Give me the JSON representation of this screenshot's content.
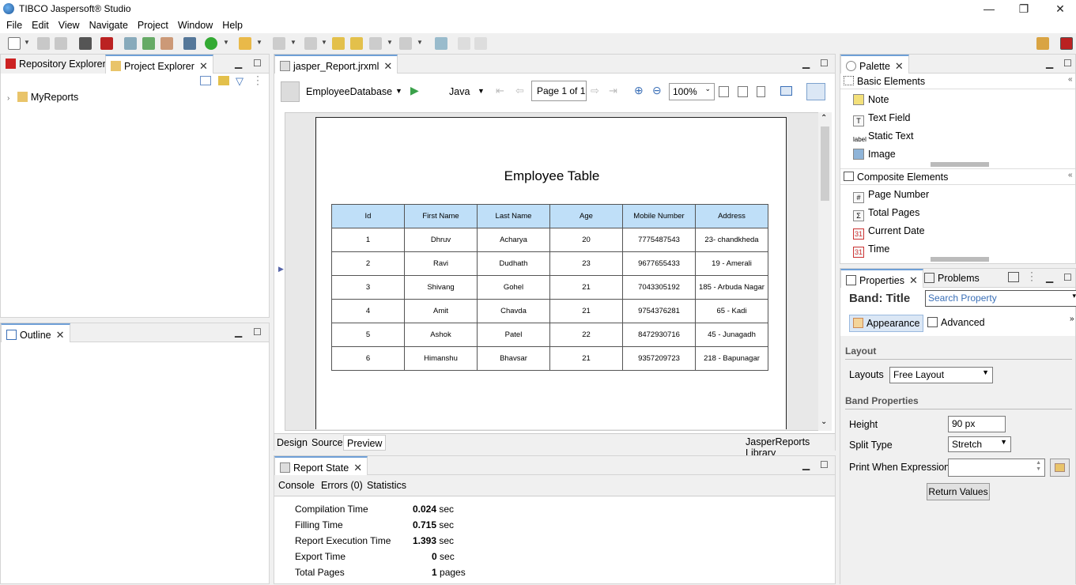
{
  "window": {
    "title": "TIBCO Jaspersoft® Studio",
    "minimize": "—",
    "restore": "❐",
    "close": "✕"
  },
  "menu": [
    "File",
    "Edit",
    "View",
    "Navigate",
    "Project",
    "Window",
    "Help"
  ],
  "left_panel": {
    "tabs": [
      {
        "label": "Repository Explorer"
      },
      {
        "label": "Project Explorer"
      }
    ],
    "tree": [
      {
        "label": "MyReports"
      }
    ]
  },
  "outline_panel": {
    "tab_label": "Outline"
  },
  "editor": {
    "tab_label": "jasper_Report.jrxml",
    "datasource": "EmployeeDatabase",
    "language": "Java",
    "page_indicator": "Page 1 of 1",
    "zoom": "100%",
    "bottom_tabs": [
      "Design",
      "Source",
      "Preview"
    ],
    "library_label": "JasperReports Library",
    "report": {
      "title": "Employee Table",
      "columns": [
        "Id",
        "First Name",
        "Last Name",
        "Age",
        "Mobile Number",
        "Address"
      ],
      "rows": [
        [
          "1",
          "Dhruv",
          "Acharya",
          "20",
          "7775487543",
          "23- chandkheda"
        ],
        [
          "2",
          "Ravi",
          "Dudhath",
          "23",
          "9677655433",
          "19 - Amerali"
        ],
        [
          "3",
          "Shivang",
          "Gohel",
          "21",
          "7043305192",
          "185 - Arbuda Nagar"
        ],
        [
          "4",
          "Amit",
          "Chavda",
          "21",
          "9754376281",
          "65 - Kadi"
        ],
        [
          "5",
          "Ashok",
          "Patel",
          "22",
          "8472930716",
          "45 - Junagadh"
        ],
        [
          "6",
          "Himanshu",
          "Bhavsar",
          "21",
          "9357209723",
          "218 - Bapunagar"
        ]
      ]
    }
  },
  "report_state": {
    "tab_label": "Report State",
    "subtabs": [
      "Console",
      "Errors (0)",
      "Statistics"
    ],
    "stats": [
      {
        "label": "Compilation Time",
        "value": "0.024",
        "unit": "sec"
      },
      {
        "label": "Filling Time",
        "value": "0.715",
        "unit": "sec"
      },
      {
        "label": "Report Execution Time",
        "value": "1.393",
        "unit": "sec"
      },
      {
        "label": "Export Time",
        "value": "0",
        "unit": "sec"
      },
      {
        "label": "Total Pages",
        "value": "1",
        "unit": "pages"
      }
    ]
  },
  "palette": {
    "tab_label": "Palette",
    "basic_header": "Basic Elements",
    "basic_items": [
      {
        "label": "Note",
        "icon": "note-icon"
      },
      {
        "label": "Text Field",
        "icon": "text-field-icon"
      },
      {
        "label": "Static Text",
        "icon": "static-text-icon",
        "icon_text": "label"
      },
      {
        "label": "Image",
        "icon": "image-icon"
      }
    ],
    "composite_header": "Composite Elements",
    "composite_items": [
      {
        "label": "Page Number",
        "icon": "page-number-icon",
        "icon_text": "#"
      },
      {
        "label": "Total Pages",
        "icon": "total-pages-icon",
        "icon_text": "Σ"
      },
      {
        "label": "Current Date",
        "icon": "calendar-icon",
        "icon_text": "31"
      },
      {
        "label": "Time",
        "icon": "calendar-icon",
        "icon_text": "31"
      }
    ]
  },
  "properties": {
    "tabs": [
      "Properties",
      "Problems"
    ],
    "band_title": "Band: Title",
    "search_placeholder": "Search Property",
    "subtabs": [
      "Appearance",
      "Advanced"
    ],
    "layout_section": "Layout",
    "layouts_label": "Layouts",
    "layouts_value": "Free Layout",
    "band_section": "Band Properties",
    "height_label": "Height",
    "height_value": "90 px",
    "split_label": "Split Type",
    "split_value": "Stretch",
    "print_label": "Print When Expression",
    "return_button": "Return Values"
  },
  "colors": {
    "header_fill": "#bfdff8",
    "accent": "#6e9fd6",
    "play": "#3aa14a"
  }
}
